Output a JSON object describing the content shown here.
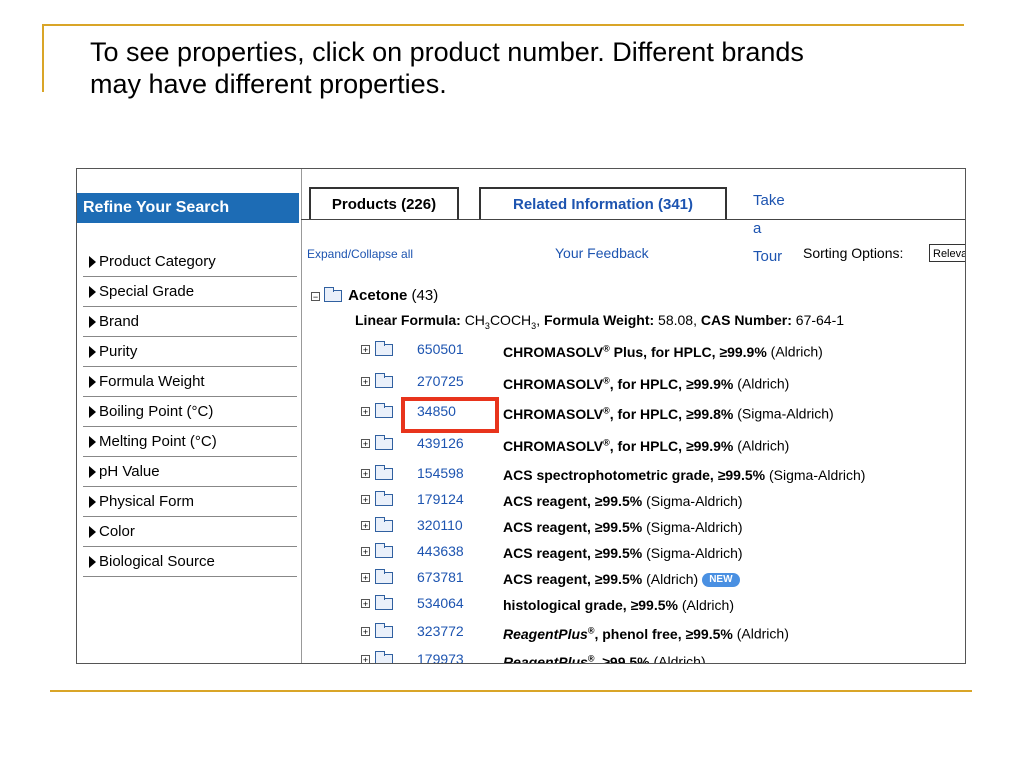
{
  "slide": {
    "line1": "To see properties, click on product number.  Different brands",
    "line2": "may have different properties."
  },
  "sidebar": {
    "header": "Refine Your Search",
    "items": [
      {
        "label": "Product Category"
      },
      {
        "label": "Special Grade"
      },
      {
        "label": "Brand"
      },
      {
        "label": "Purity"
      },
      {
        "label": "Formula Weight"
      },
      {
        "label": "Boiling Point (°C)"
      },
      {
        "label": "Melting Point (°C)"
      },
      {
        "label": "pH Value"
      },
      {
        "label": "Physical Form"
      },
      {
        "label": "Color"
      },
      {
        "label": "Biological Source"
      }
    ]
  },
  "tabs": {
    "products": "Products (226)",
    "related": "Related Information (341)",
    "tour": "Take a Tour"
  },
  "toolbar": {
    "expand": "Expand/Collapse all",
    "feedback": "Your Feedback",
    "sort_label": "Sorting Options:",
    "sort_value": "Relevance"
  },
  "group": {
    "expander": "−",
    "name": "Acetone",
    "count": "(43)",
    "linear_formula_label": "Linear Formula:",
    "linear_formula_parts": [
      "CH",
      "3",
      "COCH",
      "3"
    ],
    "formula_weight_label": "Formula Weight:",
    "formula_weight": "58.08",
    "cas_label": "CAS Number:",
    "cas": "67-64-1"
  },
  "products": [
    {
      "number": "650501",
      "name": "CHROMASOLV",
      "mark": "®",
      "rest": " Plus, for HPLC, ≥99.9%",
      "brand": "(Aldrich)"
    },
    {
      "number": "270725",
      "name": "CHROMASOLV",
      "mark": "®",
      "rest": ", for HPLC, ≥99.9%",
      "brand": "(Aldrich)"
    },
    {
      "number": "34850",
      "name": "CHROMASOLV",
      "mark": "®",
      "rest": ", for HPLC, ≥99.8%",
      "brand": "(Sigma-Aldrich)"
    },
    {
      "number": "439126",
      "name": "CHROMASOLV",
      "mark": "®",
      "rest": ", for HPLC, ≥99.9%",
      "brand": "(Aldrich)"
    },
    {
      "number": "154598",
      "name": "ACS spectrophotometric grade, ≥99.5%",
      "mark": "",
      "rest": "",
      "brand": "(Sigma-Aldrich)"
    },
    {
      "number": "179124",
      "name": "ACS reagent, ≥99.5%",
      "mark": "",
      "rest": "",
      "brand": "(Sigma-Aldrich)"
    },
    {
      "number": "320110",
      "name": "ACS reagent, ≥99.5%",
      "mark": "",
      "rest": "",
      "brand": "(Sigma-Aldrich)"
    },
    {
      "number": "443638",
      "name": "ACS reagent, ≥99.5%",
      "mark": "",
      "rest": "",
      "brand": "(Sigma-Aldrich)"
    },
    {
      "number": "673781",
      "name": "ACS reagent, ≥99.5%",
      "mark": "",
      "rest": "",
      "brand": "(Aldrich)",
      "badge": "NEW"
    },
    {
      "number": "534064",
      "name": "histological grade, ≥99.5%",
      "mark": "",
      "rest": "",
      "brand": "(Aldrich)"
    },
    {
      "number": "323772",
      "name": "ReagentPlus",
      "mark": "®",
      "rest": ", phenol free, ≥99.5%",
      "brand": "(Aldrich)",
      "italic": true
    },
    {
      "number": "179973",
      "name": "ReagentPlus",
      "mark": "®",
      "rest": ", ≥99.5%",
      "brand": "(Aldrich)",
      "italic": true
    }
  ],
  "colors": {
    "accent_line": "#d9a528",
    "header_blue": "#1d6cb5",
    "link_blue": "#1d54b0",
    "highlight_red": "#e8341c"
  },
  "icons": [
    "expand-icon",
    "folder-icon",
    "triangle-right-icon"
  ]
}
